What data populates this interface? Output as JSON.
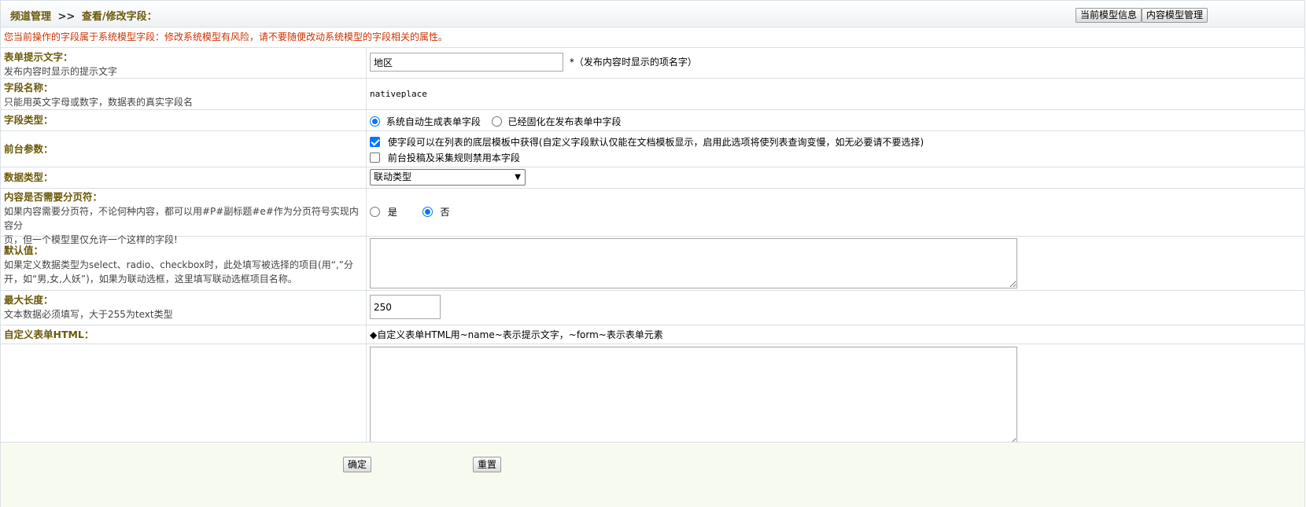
{
  "header": {
    "breadcrumb_root": "频道管理",
    "breadcrumb_sep": ">>",
    "breadcrumb_current": "查看/修改字段：",
    "btn_model_info": "当前模型信息",
    "btn_model_manage": "内容模型管理"
  },
  "warning": "您当前操作的字段属于系统模型字段：修改系统模型有风险，请不要随便改动系统模型的字段相关的属性。",
  "fields": {
    "label": {
      "title": "表单提示文字：",
      "desc": "发布内容时显示的提示文字",
      "value": "地区",
      "note": "*（发布内容时显示的项名字）"
    },
    "name": {
      "title": "字段名称：",
      "desc": "只能用英文字母或数字，数据表的真实字段名",
      "value": "nativeplace"
    },
    "type": {
      "title": "字段类型：",
      "opt1": "系统自动生成表单字段",
      "opt2": "已经固化在发布表单中字段",
      "selected": "opt1"
    },
    "front": {
      "title": "前台参数：",
      "chk1": "使字段可以在列表的底层模板中获得(自定义字段默认仅能在文档模板显示，启用此选项将使列表查询变慢，如无必要请不要选择)",
      "chk1_checked": true,
      "chk2": "前台投稿及采集规则禁用本字段",
      "chk2_checked": false
    },
    "datatype": {
      "title": "数据类型：",
      "selected": "联动类型"
    },
    "pagebreak": {
      "title": "内容是否需要分页符：",
      "desc1": "如果内容需要分页符，不论何种内容，都可以用#P#副标题#e#作为分页符号实现内容分",
      "desc2": "页，但一个模型里仅允许一个这样的字段!",
      "yes": "是",
      "no": "否",
      "selected": "no"
    },
    "default": {
      "title": "默认值：",
      "desc1": "如果定义数据类型为select、radio、checkbox时，此处填写被选择的项目(用“,”分",
      "desc2": "开，如“男,女,人妖”)，如果为联动选框，这里填写联动选框项目名称。",
      "value": ""
    },
    "maxlen": {
      "title": "最大长度：",
      "desc": "文本数据必须填写，大于255为text类型",
      "value": "250"
    },
    "customhtml": {
      "title": "自定义表单HTML：",
      "hint": "◆自定义表单HTML用~name~表示提示文字，~form~表示表单元素",
      "value": ""
    }
  },
  "footer": {
    "ok": "确定",
    "reset": "重置"
  },
  "colors": {
    "label": "#6b5a0b",
    "warning": "#cc3300",
    "footer_bg": "#f7faee",
    "accent": "#0075ff"
  }
}
